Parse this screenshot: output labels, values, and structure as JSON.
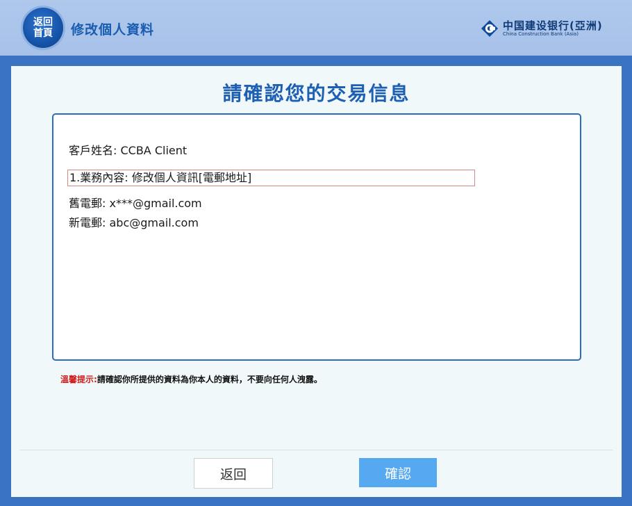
{
  "header": {
    "home_button": {
      "line1": "返回",
      "line2": "首頁"
    },
    "title": "修改個人資料",
    "brand": {
      "name_cn": "中国建设银行(亞洲)",
      "name_en": "China Construction Bank (Asia)",
      "logo_icon": "ccb-logo-icon"
    }
  },
  "main": {
    "heading": "請確認您的交易信息",
    "details": {
      "customer": "客戶姓名:  CCBA Client",
      "business": "1.業務內容:  修改個人資訊[電郵地址]",
      "old_email": "舊電郵:  x***@gmail.com",
      "new_email": "新電郵:  abc@gmail.com"
    },
    "notice": {
      "label": "溫馨提示:",
      "text": "請確認你所提供的資料為你本人的資料，不要向任何人洩露。"
    },
    "buttons": {
      "back": "返回",
      "confirm": "確認"
    }
  },
  "colors": {
    "brand_blue": "#1d5fb3",
    "header_bg": "#afc8ec",
    "outer_bg": "#3a73c2",
    "confirm_button": "#56a8f0",
    "notice_red": "#d0201e"
  }
}
